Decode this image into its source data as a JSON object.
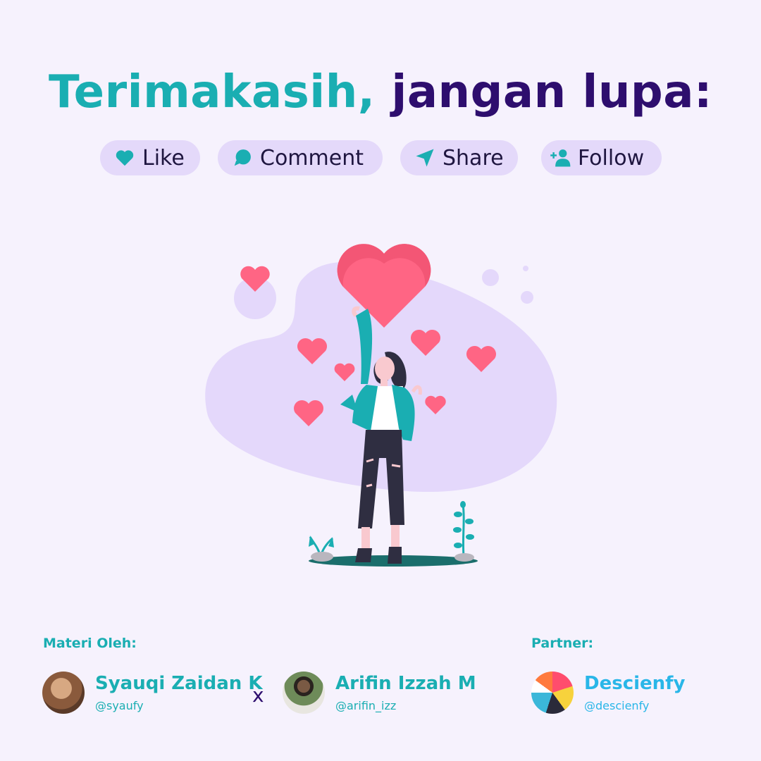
{
  "header": {
    "title_part1": "Terimakasih,",
    "title_part2": "jangan lupa:"
  },
  "actions": [
    {
      "label": "Like",
      "icon": "heart-icon"
    },
    {
      "label": "Comment",
      "icon": "speech-bubble-icon"
    },
    {
      "label": "Share",
      "icon": "paper-plane-icon"
    },
    {
      "label": "Follow",
      "icon": "add-user-icon"
    }
  ],
  "credits": {
    "materi_label": "Materi Oleh:",
    "separator": "x",
    "authors": [
      {
        "name": "Syauqi Zaidan K",
        "handle": "@syaufy"
      },
      {
        "name": "Arifin Izzah M",
        "handle": "@arifin_izz"
      }
    ],
    "partner_label": "Partner:",
    "partner": {
      "name": "Descienfy",
      "handle": "@descienfy"
    }
  },
  "colors": {
    "background": "#f6f2fd",
    "teal": "#1aaeb2",
    "navy": "#2e0e6e",
    "pill": "#e4d9fa",
    "heart": "#ff6584",
    "partner_blue": "#29b6e8"
  }
}
